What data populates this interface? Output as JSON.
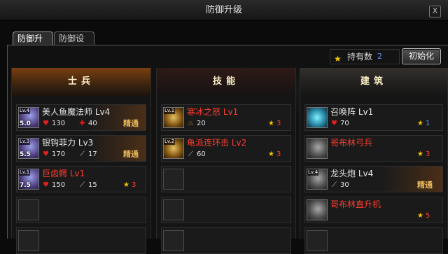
{
  "window": {
    "title": "防御升级",
    "close_label": "X"
  },
  "tabs": [
    {
      "label": "防御升级",
      "active": true
    },
    {
      "label": "防御设置",
      "active": false
    }
  ],
  "owned": {
    "label": "持有数",
    "value": "2",
    "icon": "star-icon"
  },
  "reset_button": "初始化",
  "columns": {
    "soldier": {
      "title": "士兵",
      "rows": [
        {
          "name": "美人鱼魔法师 Lv4",
          "lv_tag": "Lv.4",
          "badge": "5.0",
          "hp": "130",
          "atk": "40",
          "atk_icon": "cross-icon",
          "elite": "精通"
        },
        {
          "name": "银钩菲力 Lv3",
          "lv_tag": "Lv.3",
          "badge": "5.5",
          "hp": "170",
          "atk": "17",
          "atk_icon": "sword-icon",
          "elite": "精通"
        },
        {
          "name": "巨齿鳄 Lv1",
          "lv_tag": "Lv.1",
          "badge": "7.5",
          "hp": "150",
          "atk": "15",
          "atk_icon": "sword-icon",
          "cost": "3"
        }
      ]
    },
    "skill": {
      "title": "技能",
      "rows": [
        {
          "name": "寒冰之怒 Lv1",
          "lv_tag": "Lv.1",
          "stat": "20",
          "stat_icon": "fire-icon",
          "cost": "3"
        },
        {
          "name": "龟派连环击 Lv2",
          "lv_tag": "Lv.2",
          "stat": "60",
          "stat_icon": "sword-icon",
          "cost": "3"
        }
      ]
    },
    "building": {
      "title": "建筑",
      "rows": [
        {
          "name": "召唤阵 Lv1",
          "stat": "70",
          "stat_icon": "heart-icon",
          "cost": "1",
          "cost_color": "blue"
        },
        {
          "name": "哥布林弓兵",
          "cost": "3",
          "cost_color": "red"
        },
        {
          "name": "龙头炮 Lv4",
          "lv_tag": "Lv.4",
          "stat": "30",
          "stat_icon": "sword-icon",
          "elite": "精通"
        },
        {
          "name": "哥布林直升机",
          "cost": "5",
          "cost_color": "red"
        }
      ]
    }
  },
  "colors": {
    "accent_red": "#ff3d2e",
    "accent_blue": "#6f8cff",
    "star": "#f2c200",
    "elite": "#e8b85a"
  }
}
